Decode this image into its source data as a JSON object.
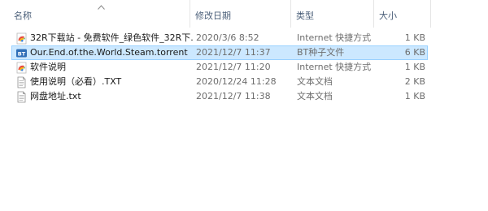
{
  "columns": {
    "name": "名称",
    "date": "修改日期",
    "type": "类型",
    "size": "大小"
  },
  "sort": {
    "column": "name",
    "direction": "ascending"
  },
  "files": [
    {
      "name": "32R下载站 - 免费软件_绿色软件_32R下...",
      "date": "2020/3/6 8:52",
      "type": "Internet 快捷方式",
      "size": "1 KB",
      "icon": "internet-shortcut-icon",
      "selected": false
    },
    {
      "name": "Our.End.of.the.World.Steam.torrent",
      "date": "2021/12/7 11:37",
      "type": "BT种子文件",
      "size": "6 KB",
      "icon": "bt-torrent-icon",
      "selected": true
    },
    {
      "name": "软件说明",
      "date": "2021/12/7 11:20",
      "type": "Internet 快捷方式",
      "size": "1 KB",
      "icon": "internet-shortcut-icon",
      "selected": false
    },
    {
      "name": "使用说明（必看）.TXT",
      "date": "2020/12/24 11:28",
      "type": "文本文档",
      "size": "2 KB",
      "icon": "text-document-icon",
      "selected": false
    },
    {
      "name": "网盘地址.txt",
      "date": "2021/12/7 11:38",
      "type": "文本文档",
      "size": "1 KB",
      "icon": "text-document-icon",
      "selected": false
    }
  ],
  "colors": {
    "selection_bg": "#cce8ff",
    "selection_border": "#99d1ff",
    "header_text": "#4c607a",
    "secondary_text": "#6d6d6d"
  }
}
